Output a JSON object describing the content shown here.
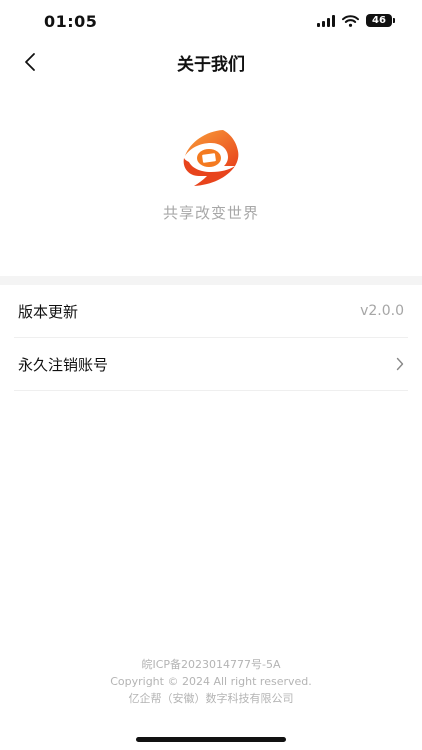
{
  "status_bar": {
    "time": "01:05",
    "battery": "46"
  },
  "nav": {
    "title": "关于我们"
  },
  "brand": {
    "slogan": "共享改变世界",
    "logo_colors": [
      "#f47a20",
      "#e8441c"
    ]
  },
  "settings": {
    "items": [
      {
        "label": "版本更新",
        "value": "v2.0.0"
      },
      {
        "label": "永久注销账号"
      }
    ]
  },
  "footer": {
    "icp": "皖ICP备2023014777号-5A",
    "copyright": "Copyright © 2024 All right reserved.",
    "company": "亿企帮（安徽）数字科技有限公司"
  }
}
